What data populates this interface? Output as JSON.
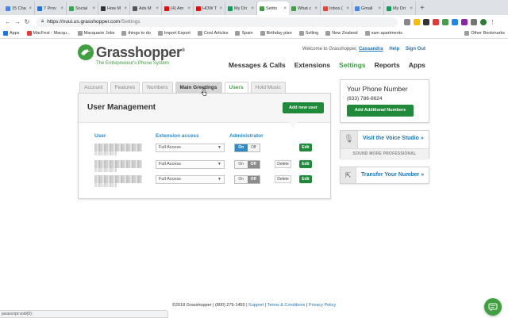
{
  "browser": {
    "tabs": [
      {
        "title": "15 Cha",
        "color": "#4285f4"
      },
      {
        "title": "7 Prov",
        "color": "#1a73e8"
      },
      {
        "title": "Social",
        "color": "#34a853"
      },
      {
        "title": "How M",
        "color": "#333333"
      },
      {
        "title": "Ads M",
        "color": "#555555"
      },
      {
        "title": "(4) Am",
        "color": "#ff0000"
      },
      {
        "title": "HOW T",
        "color": "#ff0000"
      },
      {
        "title": "My Dri",
        "color": "#0f9d58"
      },
      {
        "title": "Settin",
        "color": "#3ea041"
      },
      {
        "title": "What c",
        "color": "#3ea041"
      },
      {
        "title": "Inbox (",
        "color": "#ea4335"
      },
      {
        "title": "Gmail",
        "color": "#4285f4"
      },
      {
        "title": "My Dri",
        "color": "#0f9d58"
      }
    ],
    "active_tab_index": 8,
    "url_host": "https://nuui.us.grasshopper.com",
    "url_path": "/Settings",
    "bookmarks": [
      "Apps",
      "MacFest - Macqu...",
      "Macquarie Jobs",
      "things to do",
      "Import Export",
      "Cool Articles",
      "Spain",
      "Birthday plan",
      "Selling",
      "New Zealand",
      "sam apartments"
    ],
    "other_bookmarks": "Other Bookmarks",
    "status_text": "javascript:void(0);"
  },
  "brand": {
    "name": "Grasshopper",
    "trademark": "®",
    "tagline": "The Entrepreneur's Phone System",
    "green": "#3ea041"
  },
  "header": {
    "welcome_prefix": "Welcome to Grasshopper,",
    "username": "Cassandra",
    "help": "Help",
    "signout": "Sign Out",
    "nav": [
      "Messages & Calls",
      "Extensions",
      "Settings",
      "Reports",
      "Apps"
    ],
    "active_nav": "Settings"
  },
  "settings_tabs": [
    "Account",
    "Features",
    "Numbers",
    "Main Greetings",
    "Users",
    "Hold Music"
  ],
  "active_settings_tab": "Users",
  "hover_settings_tab": "Main Greetings",
  "user_management": {
    "title": "User Management",
    "add_button": "Add new user",
    "columns": {
      "user": "User",
      "extension": "Extension access",
      "admin": "Administrator"
    },
    "on_label": "On",
    "off_label": "Off",
    "delete_label": "Delete",
    "edit_label": "Edit",
    "rows": [
      {
        "access": "Full Access",
        "admin": true,
        "deletable": false
      },
      {
        "access": "Full Access",
        "admin": false,
        "deletable": true
      },
      {
        "access": "Full Access",
        "admin": false,
        "deletable": true
      }
    ]
  },
  "sidebar": {
    "phone_title": "Your Phone Number",
    "phone_number": "(833) 786-8624",
    "add_numbers": "Add Additional Numbers",
    "voice_studio": "Visit the Voice Studio »",
    "voice_sub": "SOUND MORE PROFESSIONAL",
    "transfer": "Transfer Your Number »"
  },
  "footer": {
    "copyright": "©2018 Grasshopper | (800) 279-1455 |",
    "support": "Support",
    "sep": "|",
    "terms": "Terms & Conditions",
    "privacy": "Privacy Policy"
  }
}
